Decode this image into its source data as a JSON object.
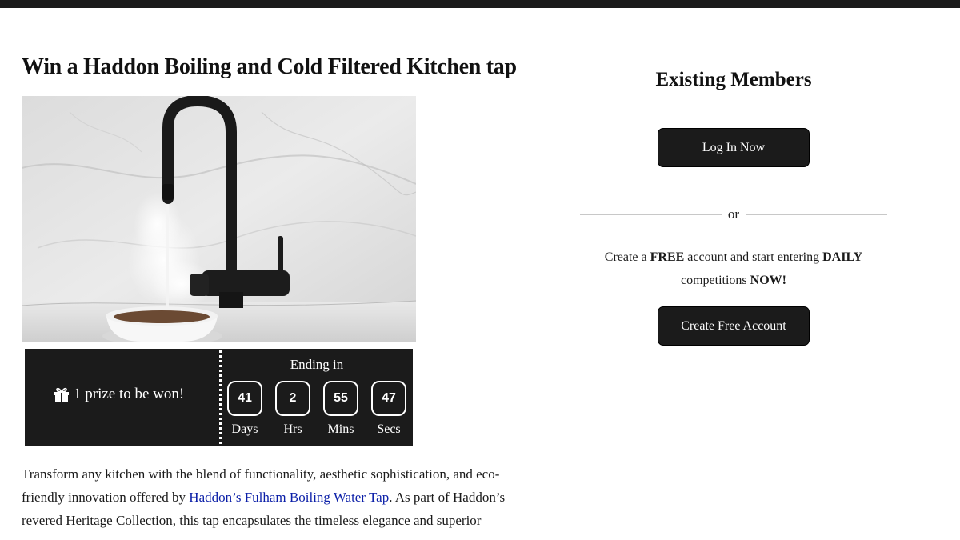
{
  "page": {
    "title": "Win a Haddon Boiling and Cold Filtered Kitchen tap"
  },
  "countdown": {
    "prize_text": "1 prize to be won!",
    "ending_label": "Ending in",
    "units": [
      {
        "value": "41",
        "label": "Days"
      },
      {
        "value": "2",
        "label": "Hrs"
      },
      {
        "value": "55",
        "label": "Mins"
      },
      {
        "value": "47",
        "label": "Secs"
      }
    ]
  },
  "description": {
    "part1": "Transform any kitchen with the blend of functionality, aesthetic sophistication, and eco-friendly innovation offered by ",
    "link_text": "Haddon’s Fulham Boiling Water Tap",
    "part2": ". As part of Haddon’s revered Heritage Collection, this tap encapsulates the timeless elegance and superior"
  },
  "sidebar": {
    "heading": "Existing Members",
    "login_label": "Log In Now",
    "or_label": "or",
    "signup_pre": "Create a ",
    "signup_free": "FREE",
    "signup_mid": " account and start entering ",
    "signup_daily": "DAILY",
    "signup_line2": "competitions ",
    "signup_now": "NOW!",
    "create_label": "Create Free Account"
  },
  "icons": {
    "gift": "gift-icon"
  },
  "colors": {
    "dark": "#1b1b1b",
    "link": "#0b1fa8",
    "background": "#ffffff"
  }
}
